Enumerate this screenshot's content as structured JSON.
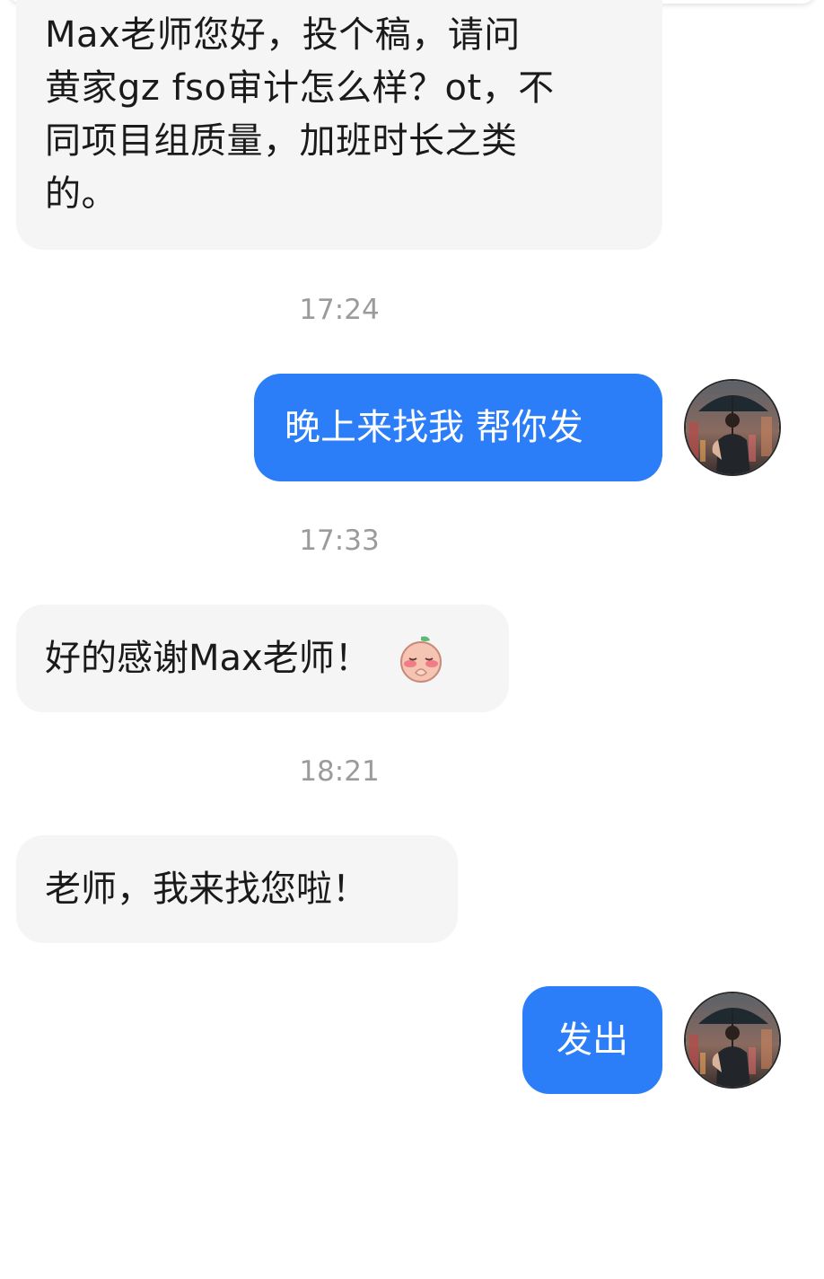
{
  "messages": [
    {
      "direction": "incoming",
      "lines": [
        "Max老师您好，投个稿，请问",
        "黄家gz fso审计怎么样？ot，不",
        "同项目组质量，加班时长之类",
        "的。"
      ]
    },
    {
      "type": "timestamp",
      "text": "17:24"
    },
    {
      "direction": "outgoing",
      "text": "晚上来找我 帮你发",
      "avatar": "user-avatar-umbrella-man"
    },
    {
      "type": "timestamp",
      "text": "17:33"
    },
    {
      "direction": "incoming",
      "text": "好的感谢Max老师！",
      "sticker": "peach-blush-praying-sticker-icon"
    },
    {
      "type": "timestamp",
      "text": "18:21"
    },
    {
      "direction": "incoming",
      "text": "老师，我来找您啦！"
    },
    {
      "direction": "outgoing",
      "text": "发出",
      "avatar": "user-avatar-umbrella-man"
    }
  ],
  "colors": {
    "incoming_bubble": "#f5f5f5",
    "outgoing_bubble": "#2b7ef8",
    "timestamp_text": "#9b9b9b",
    "page_background": "#ffffff"
  }
}
